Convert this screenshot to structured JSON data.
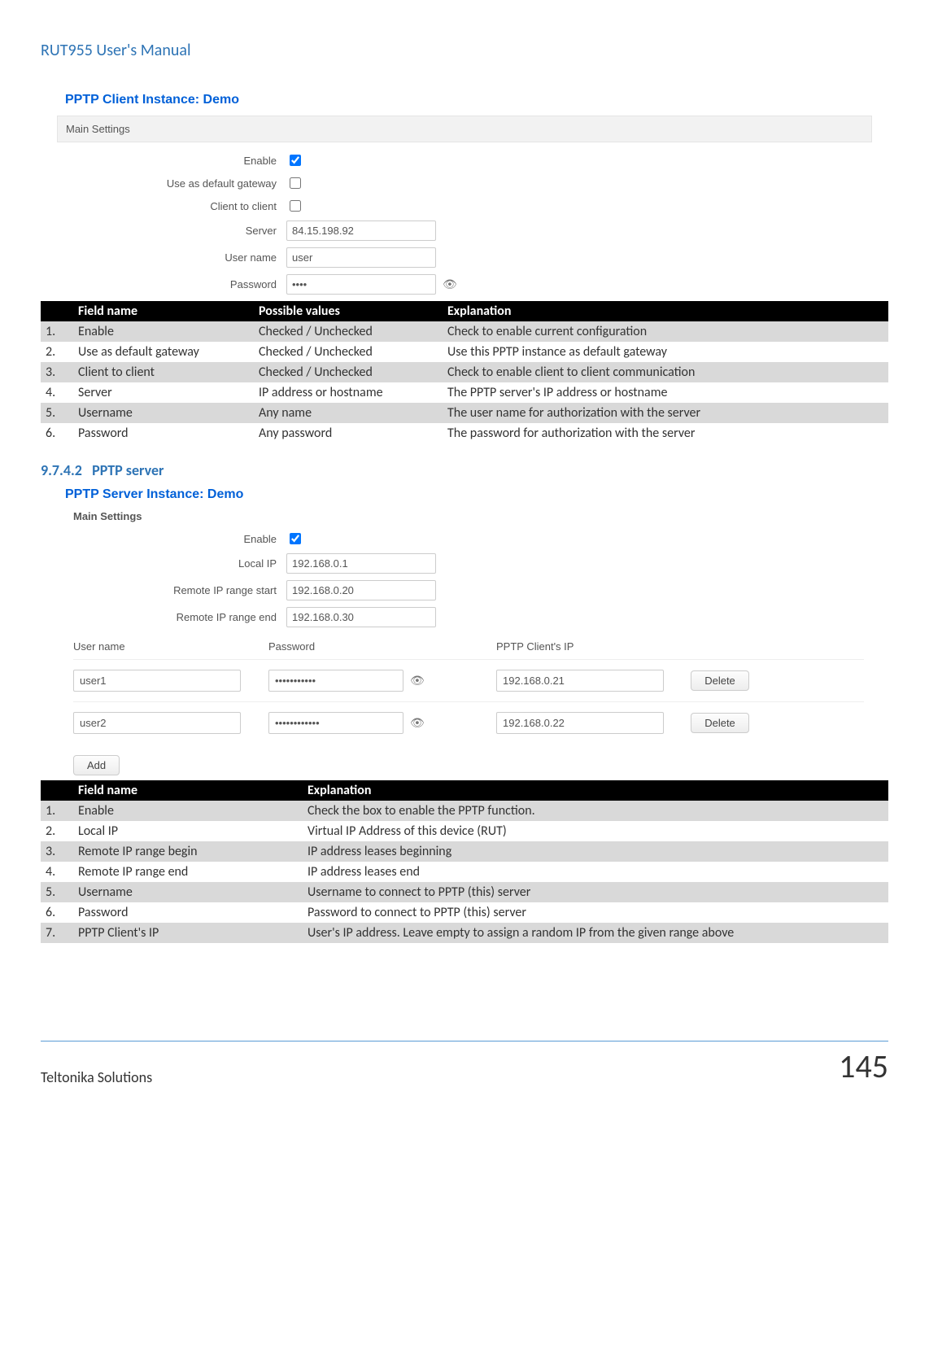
{
  "doc_header": "RUT955 User's Manual",
  "client": {
    "title": "PPTP Client Instance: Demo",
    "section": "Main Settings",
    "labels": {
      "enable": "Enable",
      "gateway": "Use as default gateway",
      "c2c": "Client to client",
      "server": "Server",
      "username": "User name",
      "password": "Password"
    },
    "values": {
      "server": "84.15.198.92",
      "username": "user",
      "password": "••••"
    },
    "table": {
      "headers": [
        "",
        "Field name",
        "Possible values",
        "Explanation"
      ],
      "rows": [
        [
          "1.",
          "Enable",
          "Checked / Unchecked",
          "Check to enable current configuration"
        ],
        [
          "2.",
          "Use as default gateway",
          "Checked / Unchecked",
          "Use this PPTP instance as default gateway"
        ],
        [
          "3.",
          "Client to client",
          "Checked / Unchecked",
          "Check to enable client to client communication"
        ],
        [
          "4.",
          "Server",
          "IP address or hostname",
          "The PPTP server's IP address or hostname"
        ],
        [
          "5.",
          "Username",
          "Any name",
          "The user name for authorization with the server"
        ],
        [
          "6.",
          "Password",
          "Any password",
          "The password for authorization with the server"
        ]
      ]
    }
  },
  "server": {
    "heading_num": "9.7.4.2",
    "heading_text": "PPTP server",
    "title": "PPTP Server Instance: Demo",
    "section": "Main Settings",
    "labels": {
      "enable": "Enable",
      "localip": "Local IP",
      "rstart": "Remote IP range start",
      "rend": "Remote IP range end"
    },
    "values": {
      "localip": "192.168.0.1",
      "rstart": "192.168.0.20",
      "rend": "192.168.0.30"
    },
    "usertable": {
      "headers": {
        "username": "User name",
        "password": "Password",
        "clientip": "PPTP Client's IP"
      },
      "rows": [
        {
          "username": "user1",
          "password": "•••••••••••",
          "clientip": "192.168.0.21"
        },
        {
          "username": "user2",
          "password": "••••••••••••",
          "clientip": "192.168.0.22"
        }
      ],
      "delete_label": "Delete",
      "add_label": "Add"
    },
    "table": {
      "headers": [
        "",
        "Field name",
        "Explanation"
      ],
      "rows": [
        [
          "1.",
          "Enable",
          "Check the box to enable the PPTP function."
        ],
        [
          "2.",
          "Local IP",
          "Virtual IP Address of this device (RUT)"
        ],
        [
          "3.",
          "Remote IP range begin",
          "IP address leases beginning"
        ],
        [
          "4.",
          "Remote IP range end",
          "IP address leases end"
        ],
        [
          "5.",
          "Username",
          "Username to connect to PPTP (this) server"
        ],
        [
          "6.",
          "Password",
          "Password to connect to PPTP (this) server"
        ],
        [
          "7.",
          "PPTP Client's IP",
          "User's IP address. Leave empty to assign a random IP from the given range above"
        ]
      ]
    }
  },
  "footer": {
    "left": "Teltonika Solutions",
    "right": "145"
  }
}
